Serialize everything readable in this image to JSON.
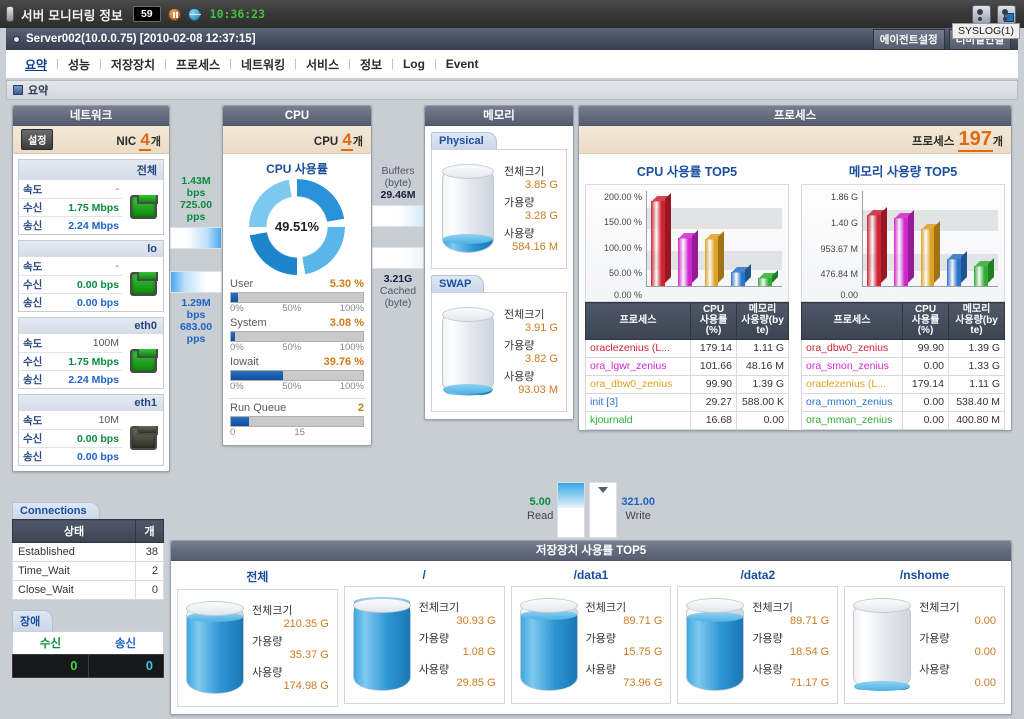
{
  "titlebar": {
    "app_title": "서버 모니터링 정보",
    "count_badge": "59",
    "pause_icon": "pause-icon",
    "globe_icon": "globe-icon",
    "clock": "10:36:23",
    "tooltip": "SYSLOG(1)",
    "right_icons": [
      "users-icon",
      "user-settings-icon"
    ]
  },
  "server": {
    "label": "Server002(10.0.0.75) [2010-02-08 12:37:15]",
    "buttons": [
      "에이전트설정",
      "터미널연결"
    ]
  },
  "tabs": [
    {
      "label": "요약",
      "active": true
    },
    {
      "label": "성능",
      "active": false
    },
    {
      "label": "저장장치",
      "active": false
    },
    {
      "label": "프로세스",
      "active": false
    },
    {
      "label": "네트워킹",
      "active": false
    },
    {
      "label": "서비스",
      "active": false
    },
    {
      "label": "정보",
      "active": false
    },
    {
      "label": "Log",
      "active": false
    },
    {
      "label": "Event",
      "active": false
    }
  ],
  "breadcrumb": "요약",
  "network": {
    "title": "네트워크",
    "settings_button": "설정",
    "nic_label": "NIC",
    "nic_count": "4",
    "nic_suffix": "개",
    "row_keys": {
      "speed": "속도",
      "rx": "수신",
      "tx": "송신"
    },
    "interfaces": [
      {
        "name": "전체",
        "speed": "-",
        "rx": "1.75 Mbps",
        "tx": "2.24 Mbps",
        "status": "up"
      },
      {
        "name": "lo",
        "speed": "-",
        "rx": "0.00 bps",
        "tx": "0.00 bps",
        "status": "up"
      },
      {
        "name": "eth0",
        "speed": "100M",
        "rx": "1.75 Mbps",
        "tx": "2.24 Mbps",
        "status": "up"
      },
      {
        "name": "eth1",
        "speed": "10M",
        "rx": "0.00 bps",
        "tx": "0.00 bps",
        "status": "down"
      }
    ],
    "flow_in": {
      "bps": "1.43M",
      "bps_unit": "bps",
      "pps": "725.00",
      "pps_unit": "pps"
    },
    "flow_out": {
      "bps": "1.29M",
      "bps_unit": "bps",
      "pps": "683.00",
      "pps_unit": "pps"
    }
  },
  "cpu": {
    "title": "CPU",
    "cpu_label": "CPU",
    "cpu_count": "4",
    "cpu_suffix": "개",
    "usage_title": "CPU 사용률",
    "donut_value": "49.51%",
    "metrics": [
      {
        "name": "User",
        "value": "5.30 %",
        "pct": 5.3,
        "scale": [
          "0%",
          "50%",
          "100%"
        ]
      },
      {
        "name": "System",
        "value": "3.08 %",
        "pct": 3.08,
        "scale": [
          "0%",
          "50%",
          "100%"
        ]
      },
      {
        "name": "Iowait",
        "value": "39.76 %",
        "pct": 39.76,
        "scale": [
          "0%",
          "50%",
          "100%"
        ]
      }
    ],
    "run_queue": {
      "name": "Run Queue",
      "value": "2",
      "pct": 13.3,
      "scale_min": "0",
      "scale_max": "15"
    }
  },
  "membuf": {
    "buffers_label": "Buffers",
    "buffers_unit": "(byte)",
    "buffers_value": "29.46M",
    "cached_value": "3.21G",
    "cached_label": "Cached",
    "cached_unit": "(byte)"
  },
  "memory": {
    "title": "메모리",
    "sections": [
      {
        "tag": "Physical",
        "total_label": "전체크기",
        "total": "3.85 G",
        "free_label": "가용량",
        "free": "3.28 G",
        "used_label": "사용량",
        "used": "584.16 M",
        "fill_pct": 15
      },
      {
        "tag": "SWAP",
        "total_label": "전체크기",
        "total": "3.91 G",
        "free_label": "가용량",
        "free": "3.82 G",
        "used_label": "사용량",
        "used": "93.03 M",
        "fill_pct": 7
      }
    ]
  },
  "process": {
    "title": "프로세스",
    "count_label": "프로세스",
    "count": "197",
    "count_suffix": "개",
    "columns": [
      "프로세스",
      "CPU 사용률 (%)",
      "메모리 사용량(byte)"
    ],
    "col_cpu_line1": "CPU",
    "col_cpu_line2": "사용률",
    "col_cpu_line3": "(%)",
    "col_mem_line1": "메모리",
    "col_mem_line2": "사용량(by",
    "col_mem_line3": "te)",
    "cpu_top5": {
      "title": "CPU 사용률 TOP5",
      "rows": [
        {
          "name": "oraclezenius (L...",
          "cpu": "179.14",
          "mem": "1.11 G",
          "color": "#cf2233"
        },
        {
          "name": "ora_lgwr_zenius",
          "cpu": "101.66",
          "mem": "48.16 M",
          "color": "#d127cf"
        },
        {
          "name": "ora_dbw0_zenius",
          "cpu": "99.90",
          "mem": "1.39 G",
          "color": "#e0a022"
        },
        {
          "name": "init [3]",
          "cpu": "29.27",
          "mem": "588.00 K",
          "color": "#2a74c9"
        },
        {
          "name": "kjournald",
          "cpu": "16.68",
          "mem": "0.00",
          "color": "#2fae33"
        }
      ]
    },
    "mem_top5": {
      "title": "메모리 사용량 TOP5",
      "rows": [
        {
          "name": "ora_dbw0_zenius",
          "cpu": "99.90",
          "mem": "1.39 G",
          "color": "#cf2233"
        },
        {
          "name": "ora_smon_zenius",
          "cpu": "0.00",
          "mem": "1.33 G",
          "color": "#d127cf"
        },
        {
          "name": "oraclezenius (L...",
          "cpu": "179.14",
          "mem": "1.11 G",
          "color": "#e0a022"
        },
        {
          "name": "ora_mmon_zenius",
          "cpu": "0.00",
          "mem": "538.40 M",
          "color": "#2a74c9"
        },
        {
          "name": "ora_mman_zenius",
          "cpu": "0.00",
          "mem": "400.80 M",
          "color": "#2fae33"
        }
      ]
    }
  },
  "connections": {
    "tag": "Connections",
    "col_state": "상태",
    "col_count": "개",
    "rows": [
      {
        "state": "Established",
        "count": "38"
      },
      {
        "state": "Time_Wait",
        "count": "2"
      },
      {
        "state": "Close_Wait",
        "count": "0"
      }
    ]
  },
  "fault": {
    "tag": "장애",
    "rx_label": "수신",
    "tx_label": "송신",
    "rx_value": "0",
    "tx_value": "0"
  },
  "disk_io": {
    "read_value": "5.00",
    "read_label": "Read",
    "write_value": "321.00",
    "write_label": "Write"
  },
  "storage": {
    "title": "저장장치 사용률 TOP5",
    "total_label": "전체크기",
    "free_label": "가용량",
    "used_label": "사용량",
    "items": [
      {
        "name": "전체",
        "total": "210.35 G",
        "free": "35.37 G",
        "used": "174.98 G",
        "fill_pct": 83
      },
      {
        "name": "/",
        "total": "30.93 G",
        "free": "1.08 G",
        "used": "29.85 G",
        "fill_pct": 96
      },
      {
        "name": "/data1",
        "total": "89.71 G",
        "free": "15.75 G",
        "used": "73.96 G",
        "fill_pct": 82
      },
      {
        "name": "/data2",
        "total": "89.71 G",
        "free": "18.54 G",
        "used": "71.17 G",
        "fill_pct": 79
      },
      {
        "name": "/nshome",
        "total": "0.00",
        "free": "0.00",
        "used": "0.00",
        "fill_pct": 4
      }
    ]
  },
  "chart_data": [
    {
      "type": "bar",
      "title": "CPU 사용률 TOP5",
      "categories": [
        "oraclezenius (L...",
        "ora_lgwr_zenius",
        "ora_dbw0_zenius",
        "init [3]",
        "kjournald"
      ],
      "values": [
        179.14,
        101.66,
        99.9,
        29.27,
        16.68
      ],
      "ylabel": "",
      "xlabel": "",
      "ytick_labels": [
        "0.00 %",
        "50.00 %",
        "100.00 %",
        "150.00 %",
        "200.00 %"
      ],
      "ylim": [
        0,
        200
      ],
      "colors": [
        "#cf2233",
        "#d127cf",
        "#e0a022",
        "#2a74c9",
        "#2fae33"
      ],
      "grid": true,
      "legend": "none"
    },
    {
      "type": "bar",
      "title": "메모리 사용량 TOP5",
      "categories": [
        "ora_dbw0_zenius",
        "ora_smon_zenius",
        "oraclezenius (L...",
        "ora_mmon_zenius",
        "ora_mman_zenius"
      ],
      "values": [
        1.39,
        1.33,
        1.11,
        0.5258,
        0.3914
      ],
      "value_labels": [
        "1.39 G",
        "1.33 G",
        "1.11 G",
        "538.40 M",
        "400.80 M"
      ],
      "ylabel": "",
      "xlabel": "",
      "ytick_labels": [
        "0.00",
        "476.84 M",
        "953.67 M",
        "1.40 G",
        "1.86 G"
      ],
      "ylim": [
        0,
        1.86
      ],
      "colors": [
        "#cf2233",
        "#d127cf",
        "#e0a022",
        "#2a74c9",
        "#2fae33"
      ],
      "grid": true,
      "legend": "none"
    }
  ]
}
